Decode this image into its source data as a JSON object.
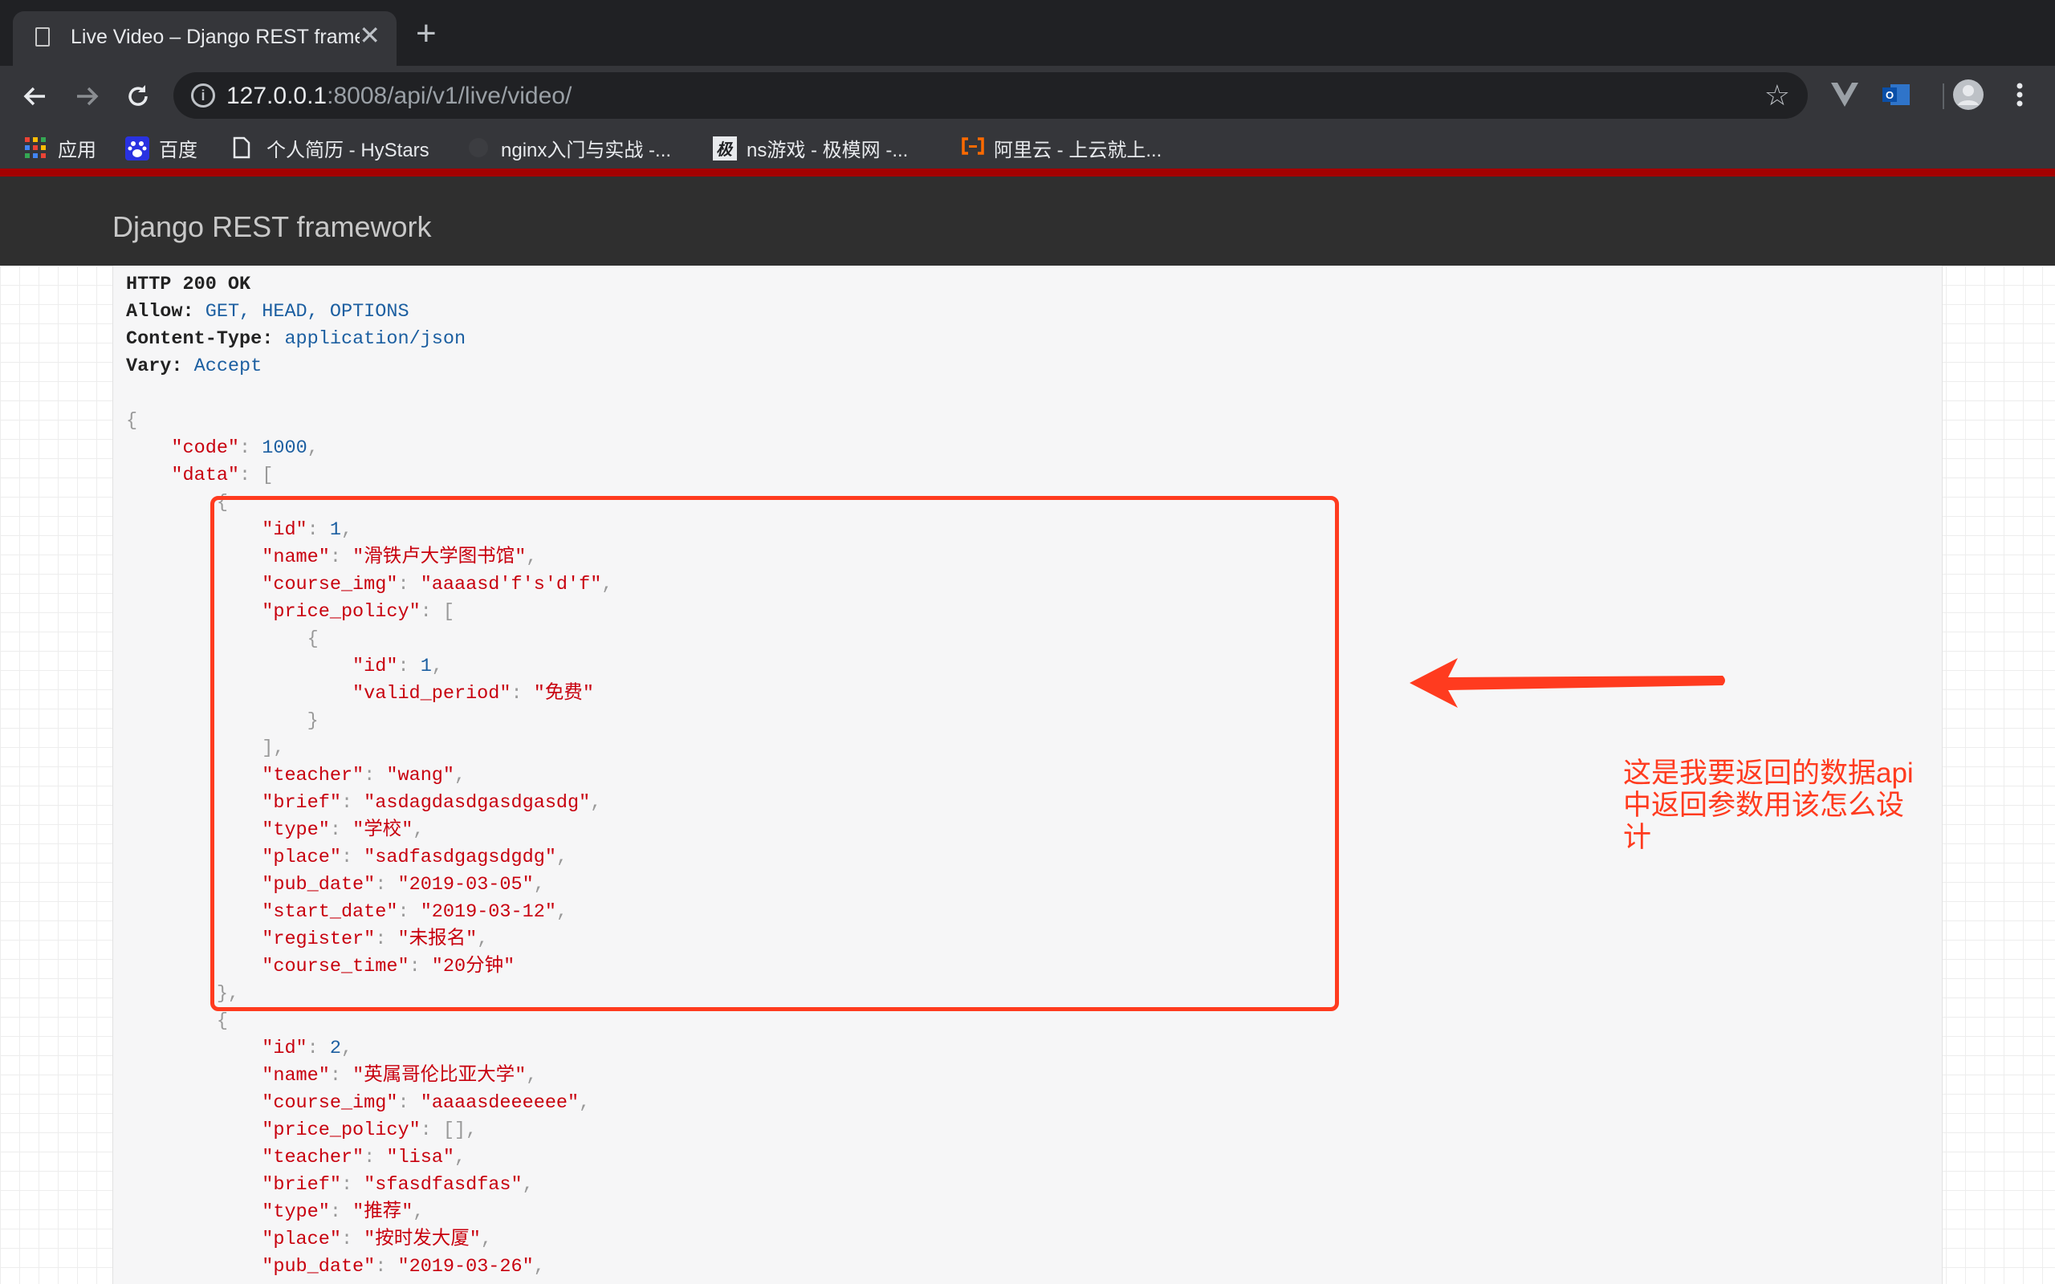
{
  "browser": {
    "tab_title": "Live Video – Django REST framework",
    "url_host": "127.0.0.1",
    "url_rest": ":8008/api/v1/live/video/",
    "new_tab_symbol": "+",
    "close_symbol": "✕"
  },
  "bookmarks": [
    {
      "label": "应用",
      "icon": "apps-grid-icon"
    },
    {
      "label": "百度",
      "icon": "baidu-paw-icon"
    },
    {
      "label": "个人简历 - HyStars",
      "icon": "document-icon"
    },
    {
      "label": "nginx入门与实战 -...",
      "icon": "github-icon"
    },
    {
      "label": "ns游戏 - 极模网 -...",
      "icon": "site-logo-icon"
    },
    {
      "label": "阿里云 - 上云就上...",
      "icon": "aliyun-icon"
    }
  ],
  "drf": {
    "brand": "Django REST framework"
  },
  "response": {
    "status": "HTTP 200 OK",
    "headers": [
      {
        "name": "Allow:",
        "value": "GET, HEAD, OPTIONS"
      },
      {
        "name": "Content-Type:",
        "value": "application/json"
      },
      {
        "name": "Vary:",
        "value": "Accept"
      }
    ],
    "code": 1000,
    "items": [
      {
        "id": 1,
        "name": "滑铁卢大学图书馆",
        "course_img": "aaaasd'f's'd'f",
        "price_policy": [
          {
            "id": 1,
            "valid_period": "免费"
          }
        ],
        "teacher": "wang",
        "brief": "asdagdasdgasdgasdg",
        "type": "学校",
        "place": "sadfasdgagsdgdg",
        "pub_date": "2019-03-05",
        "start_date": "2019-03-12",
        "register": "未报名",
        "course_time": "20分钟"
      },
      {
        "id": 2,
        "name": "英属哥伦比亚大学",
        "course_img": "aaaasdeeeeee",
        "price_policy": [],
        "teacher": "lisa",
        "brief": "sfasdfasdfas",
        "type": "推荐",
        "place": "按时发大厦",
        "pub_date": "2019-03-26"
      }
    ]
  },
  "annotation": {
    "text": "这是我要返回的数据api中返回参数用该怎么设计",
    "color": "#ff3b1f"
  }
}
